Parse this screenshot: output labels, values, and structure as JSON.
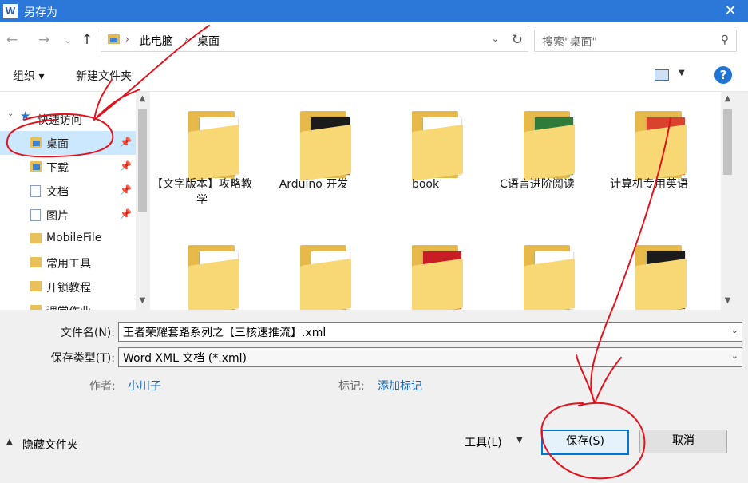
{
  "titlebar": {
    "app_icon_letter": "W",
    "title": "另存为",
    "close_glyph": "✕"
  },
  "nav": {
    "back_glyph": "←",
    "forward_glyph": "→",
    "recent_glyph": "⌄",
    "up_glyph": "↑",
    "path": [
      "此电脑",
      "桌面"
    ],
    "search_placeholder": "搜索\"桌面\"",
    "search_icon": "search-icon"
  },
  "toolbar": {
    "organize": "组织 ▾",
    "new_folder": "新建文件夹",
    "help_glyph": "?"
  },
  "sidebar": {
    "section_title": "快速访问",
    "items": [
      {
        "label": "桌面",
        "icon": "desktop-folder-icon",
        "pinned": true,
        "selected": true
      },
      {
        "label": "下载",
        "icon": "download-folder-icon",
        "pinned": true
      },
      {
        "label": "文档",
        "icon": "documents-folder-icon",
        "pinned": true
      },
      {
        "label": "图片",
        "icon": "pictures-folder-icon",
        "pinned": true
      },
      {
        "label": "MobileFile",
        "icon": "folder-icon"
      },
      {
        "label": "常用工具",
        "icon": "folder-icon"
      },
      {
        "label": "开锁教程",
        "icon": "folder-icon"
      },
      {
        "label": "课堂作业",
        "icon": "folder-icon"
      }
    ]
  },
  "files": [
    {
      "name": "【文字版本】攻略教学",
      "thumb_colors": [
        "#2b5fb3",
        "#ffffff"
      ]
    },
    {
      "name": "Arduino 开发",
      "thumb_colors": [
        "#7b2aa8",
        "#1b1b1b"
      ]
    },
    {
      "name": "book",
      "thumb_colors": [
        "#c91d25",
        "#ffffff"
      ]
    },
    {
      "name": "C语言进阶阅读",
      "thumb_colors": [
        "#b0262a",
        "#2e7b3a"
      ]
    },
    {
      "name": "计算机专用英语",
      "thumb_colors": [
        "#1f4f8a",
        "#d9432e"
      ]
    },
    {
      "name": "",
      "thumb_colors": [
        "#5a8fc8",
        "#ffffff"
      ]
    },
    {
      "name": "",
      "thumb_colors": [
        "#3a3a3a",
        "#ffffff"
      ]
    },
    {
      "name": "",
      "thumb_colors": [
        "#1a1a1a",
        "#c91d25"
      ]
    },
    {
      "name": "",
      "thumb_colors": [
        "#5a8fc8",
        "#ffffff"
      ]
    },
    {
      "name": "",
      "thumb_colors": [
        "#7b2aa8",
        "#1b1b1b"
      ]
    }
  ],
  "form": {
    "filename_label": "文件名(N):",
    "filename_value": "王者荣耀套路系列之【三核速推流】.xml",
    "filetype_label": "保存类型(T):",
    "filetype_value": "Word XML 文档 (*.xml)",
    "author_label": "作者:",
    "author_value": "小川子",
    "tags_label": "标记:",
    "tags_value": "添加标记"
  },
  "footer": {
    "hide_folders": "隐藏文件夹",
    "tools": "工具(L)",
    "save": "保存(S)",
    "cancel": "取消"
  },
  "colors": {
    "titlebar": "#2b78d8",
    "selection": "#cce8ff",
    "link": "#1467b8",
    "annotation": "#e0141e"
  }
}
